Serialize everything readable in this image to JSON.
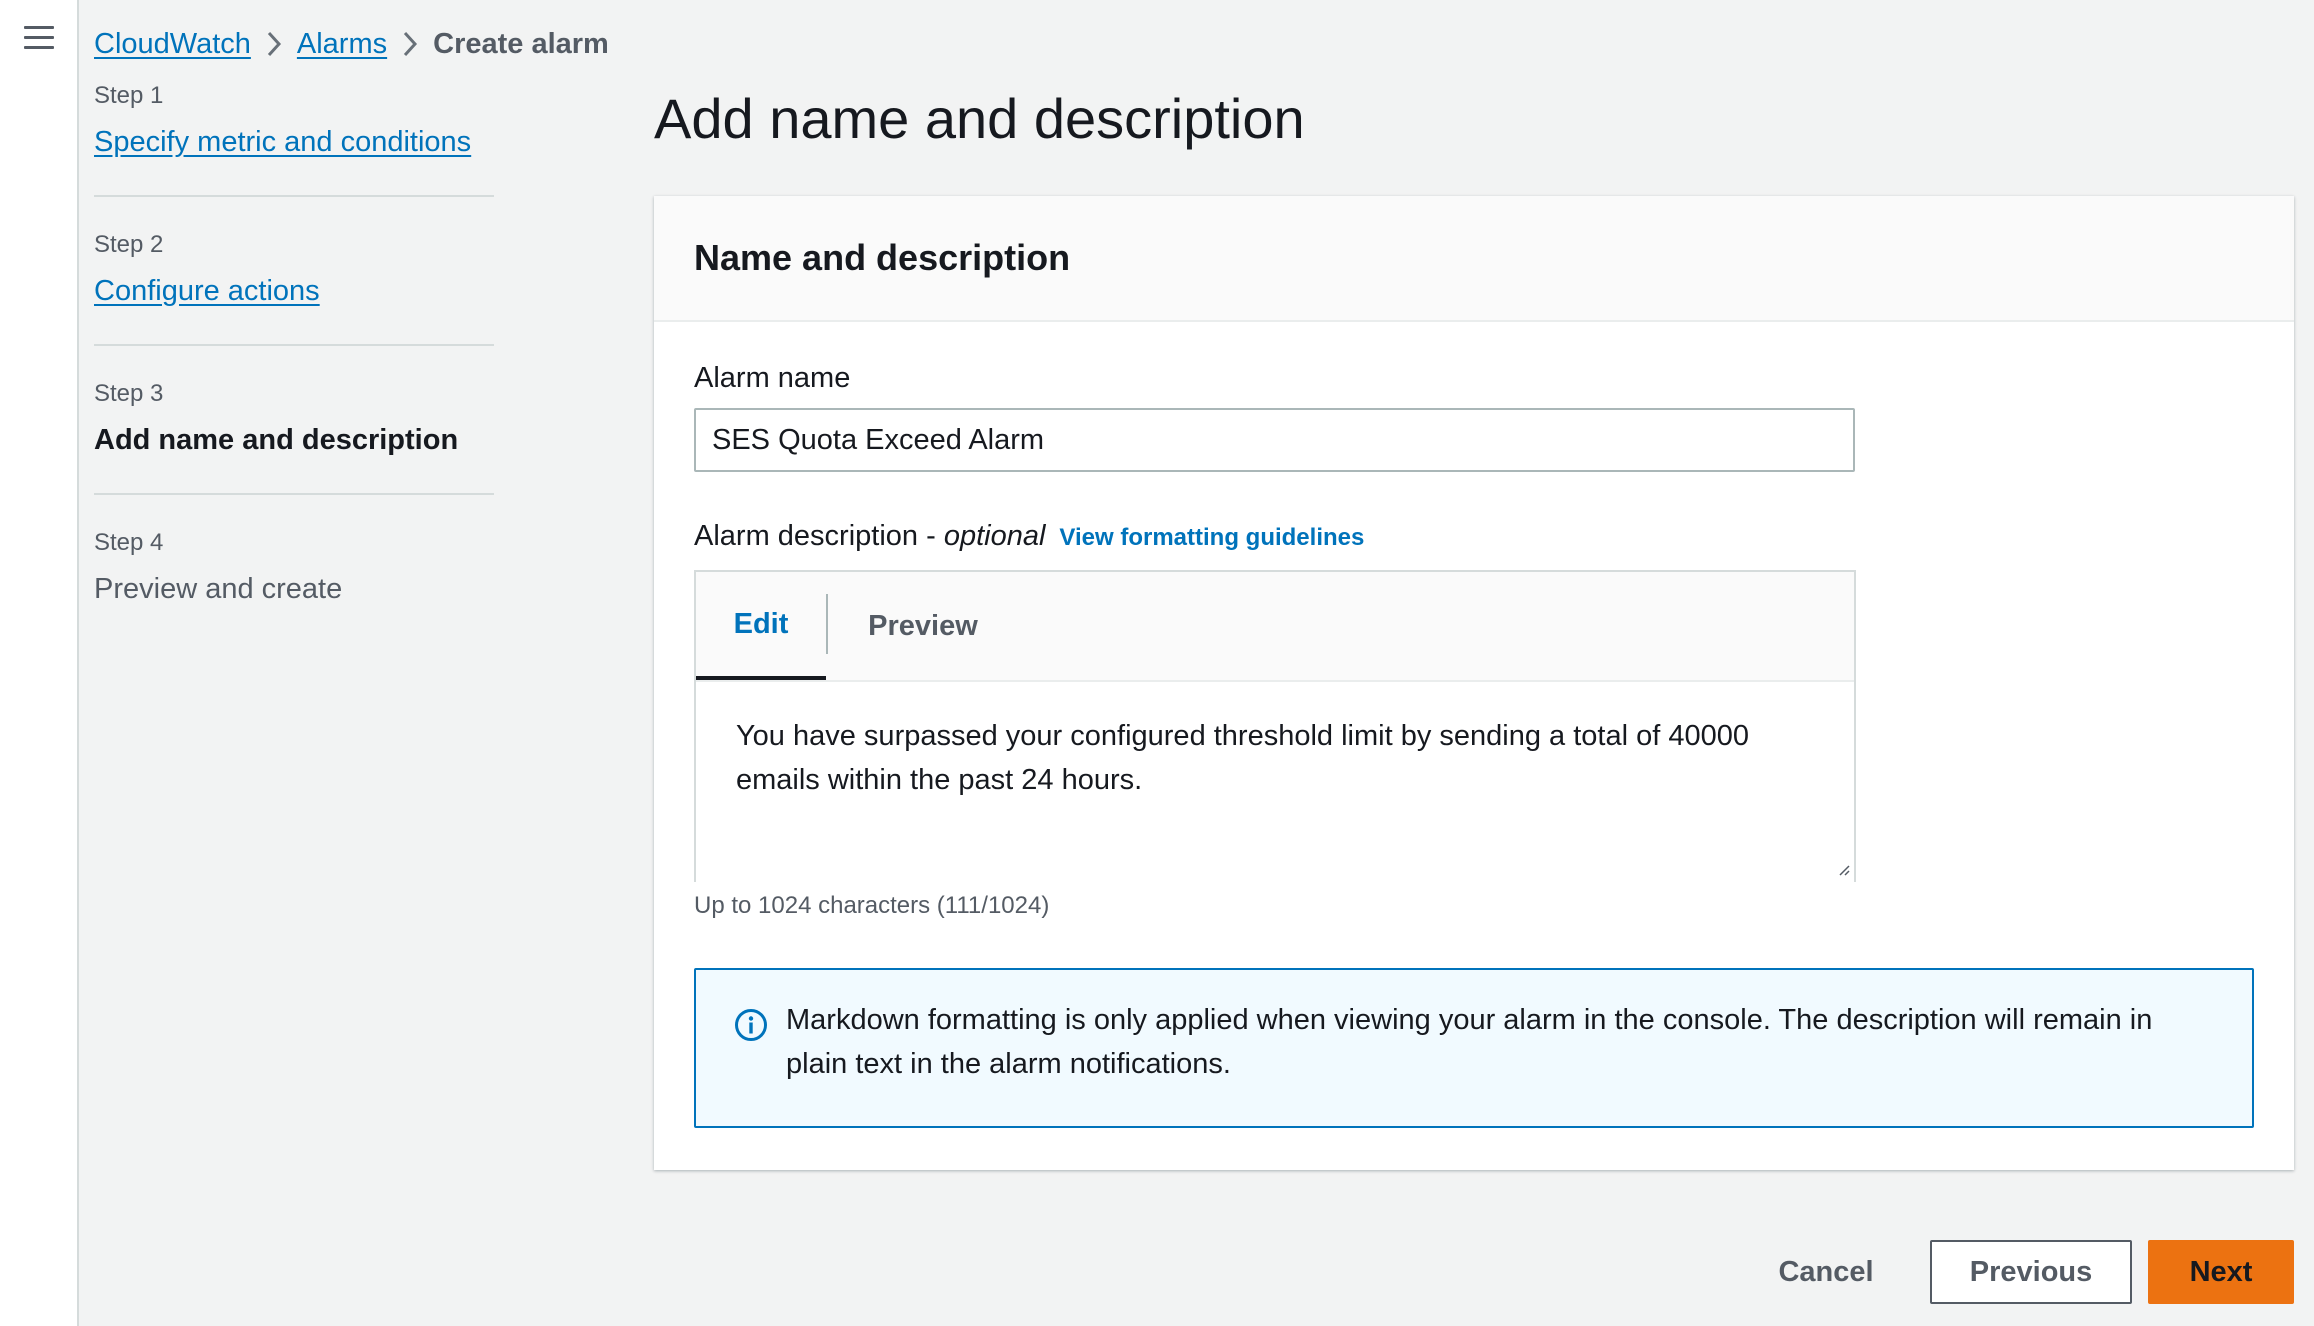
{
  "nav": {
    "menu_icon": "hamburger-menu-icon"
  },
  "breadcrumb": {
    "items": [
      {
        "label": "CloudWatch"
      },
      {
        "label": "Alarms"
      }
    ],
    "current": "Create alarm",
    "separator_icon": "chevron-right-icon"
  },
  "steps": [
    {
      "number": "Step 1",
      "label": "Specify metric and conditions",
      "state": "link"
    },
    {
      "number": "Step 2",
      "label": "Configure actions",
      "state": "link"
    },
    {
      "number": "Step 3",
      "label": "Add name and description",
      "state": "current"
    },
    {
      "number": "Step 4",
      "label": "Preview and create",
      "state": "disabled"
    }
  ],
  "page": {
    "title": "Add name and description"
  },
  "panel": {
    "title": "Name and description",
    "alarm_name": {
      "label": "Alarm name",
      "value": "SES Quota Exceed Alarm"
    },
    "alarm_description": {
      "label": "Alarm description - ",
      "optional": "optional",
      "guide_link": "View formatting guidelines",
      "tabs": [
        "Edit",
        "Preview"
      ],
      "active_tab": "Edit",
      "value": "You have surpassed your configured threshold limit by sending a total of 40000 emails within the past 24 hours.",
      "counter": "Up to 1024 characters (111/1024)"
    },
    "info": {
      "icon": "info-icon",
      "text": "Markdown formatting is only applied when viewing your alarm in the console. The description will remain in plain text in the alarm notifications."
    }
  },
  "footer": {
    "cancel": "Cancel",
    "previous": "Previous",
    "next": "Next"
  },
  "colors": {
    "link": "#0073bb",
    "primary_button": "#ec7211",
    "background": "#f2f3f3",
    "info_border": "#0073bb",
    "info_bg": "#f1faff"
  }
}
